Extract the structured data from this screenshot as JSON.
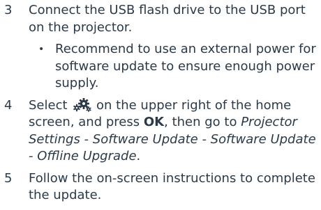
{
  "steps": [
    {
      "number": "3",
      "text": "Connect the USB flash drive to the USB port on the projector.",
      "bullets": [
        "Recommend to use an external power for software update to ensure enough power supply."
      ]
    },
    {
      "number": "4",
      "text_before_icon": "Select",
      "icon": "settings-gears-icon",
      "text_after_icon": "on the upper right of the home screen, and press",
      "key": "OK",
      "text_after_key": ", then go to",
      "menu_path": "Projector Settings - Software Update - Software Update - Offline Upgrade",
      "text_end": "."
    },
    {
      "number": "5",
      "text": "Follow the on-screen instructions to complete the update."
    }
  ],
  "colors": {
    "text": "#2b3a48"
  }
}
